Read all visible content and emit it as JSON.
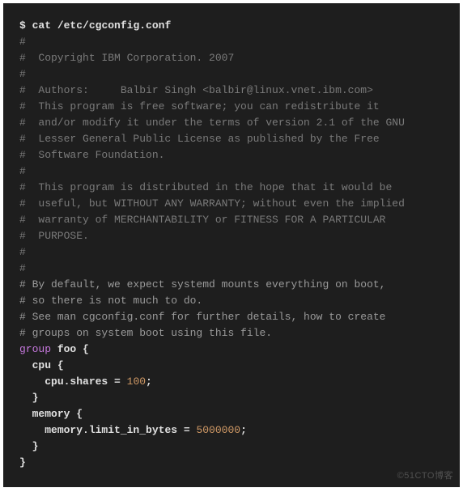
{
  "prompt": "$",
  "command": "cat /etc/cgconfig.conf",
  "comments": [
    "#",
    "#  Copyright IBM Corporation. 2007",
    "#",
    "#  Authors:     Balbir Singh <balbir@linux.vnet.ibm.com>",
    "#  This program is free software; you can redistribute it",
    "#  and/or modify it under the terms of version 2.1 of the GNU",
    "#  Lesser General Public License as published by the Free",
    "#  Software Foundation.",
    "#",
    "#  This program is distributed in the hope that it would be",
    "#  useful, but WITHOUT ANY WARRANTY; without even the implied",
    "#  warranty of MERCHANTABILITY or FITNESS FOR A PARTICULAR",
    "#  PURPOSE.",
    "#",
    "#",
    "# By default, we expect systemd mounts everything on boot,",
    "# so there is not much to do.",
    "# See man cgconfig.conf for further details, how to create",
    "# groups on system boot using this file."
  ],
  "blank_line": "",
  "config": {
    "keyword_group": "group",
    "group_name": "foo",
    "open_brace": " {",
    "indent1": "  ",
    "indent2": "    ",
    "sections": [
      {
        "name": "cpu",
        "key": "cpu.shares",
        "eq": " = ",
        "value": "100",
        "semicolon": ";"
      },
      {
        "name": "memory",
        "key": "memory.limit_in_bytes",
        "eq": " = ",
        "value": "5000000",
        "semicolon": ";"
      }
    ],
    "close_brace": "}",
    "inner_close": "  }"
  },
  "watermark": "©51CTO博客"
}
